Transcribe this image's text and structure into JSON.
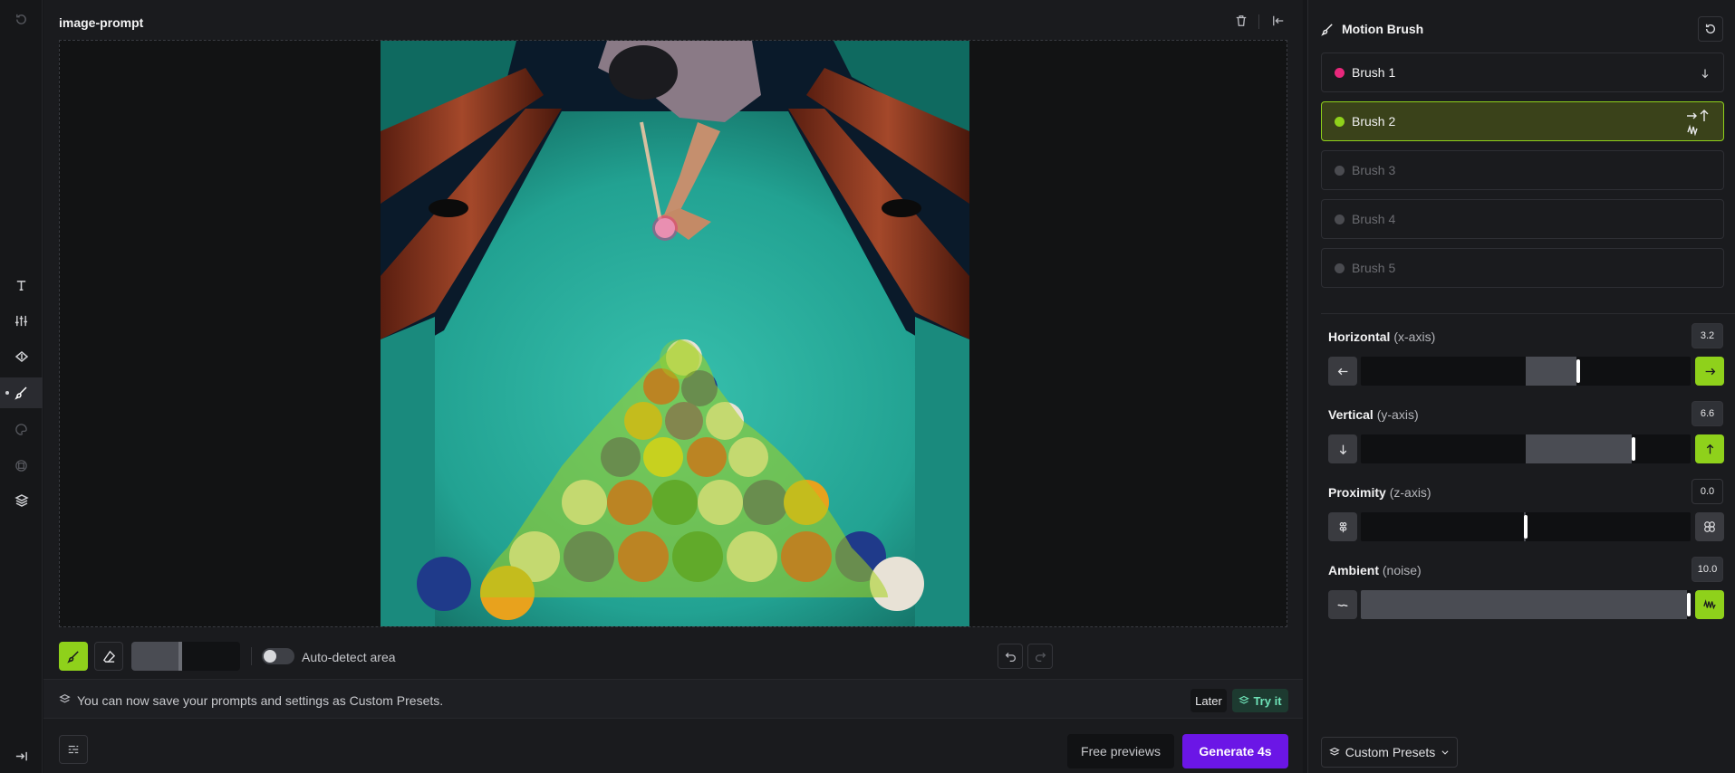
{
  "workspace": {
    "title": "image-prompt"
  },
  "left_rail": {
    "items": [
      {
        "icon": "history-icon"
      },
      {
        "icon": "text-icon"
      },
      {
        "icon": "sliders-icon"
      },
      {
        "icon": "camera-motion-icon"
      },
      {
        "icon": "motion-brush-icon",
        "active": true
      },
      {
        "icon": "palette-icon"
      },
      {
        "icon": "frame-icon"
      },
      {
        "icon": "layers-icon"
      },
      {
        "icon": "collapse-icon"
      }
    ]
  },
  "toolbar": {
    "auto_detect_label": "Auto-detect area",
    "auto_detect_on": false,
    "brush_size_fraction": 0.47
  },
  "notice": {
    "text": "You can now save your prompts and settings as Custom Presets.",
    "later_label": "Later",
    "tryit_label": "Try it"
  },
  "footer": {
    "preview_label": "Free previews",
    "generate_label": "Generate 4s"
  },
  "panel": {
    "title": "Motion Brush",
    "brushes": [
      {
        "label": "Brush 1",
        "color": "#e8287c",
        "enabled": true,
        "active": false,
        "motions": "down"
      },
      {
        "label": "Brush 2",
        "color": "#8fd11b",
        "enabled": true,
        "active": true,
        "motions": "right-up-noise"
      },
      {
        "label": "Brush 3",
        "color": "#4a4b50",
        "enabled": false,
        "active": false
      },
      {
        "label": "Brush 4",
        "color": "#4a4b50",
        "enabled": false,
        "active": false
      },
      {
        "label": "Brush 5",
        "color": "#4a4b50",
        "enabled": false,
        "active": false
      }
    ],
    "axes": [
      {
        "label": "Horizontal",
        "sub": "(x-axis)",
        "value": "3.2",
        "fraction": 0.66,
        "mode": "center"
      },
      {
        "label": "Vertical",
        "sub": "(y-axis)",
        "value": "6.6",
        "fraction": 0.83,
        "mode": "center"
      },
      {
        "label": "Proximity",
        "sub": "(z-axis)",
        "value": "0.0",
        "fraction": 0.5,
        "mode": "center"
      },
      {
        "label": "Ambient",
        "sub": "(noise)",
        "value": "10.0",
        "fraction": 1.0,
        "mode": "left"
      }
    ],
    "presets_label": "Custom Presets"
  },
  "colors": {
    "accent_green": "#8fd11b",
    "generate_purple": "#6b16e6",
    "try_teal": "#6fe3b8"
  }
}
